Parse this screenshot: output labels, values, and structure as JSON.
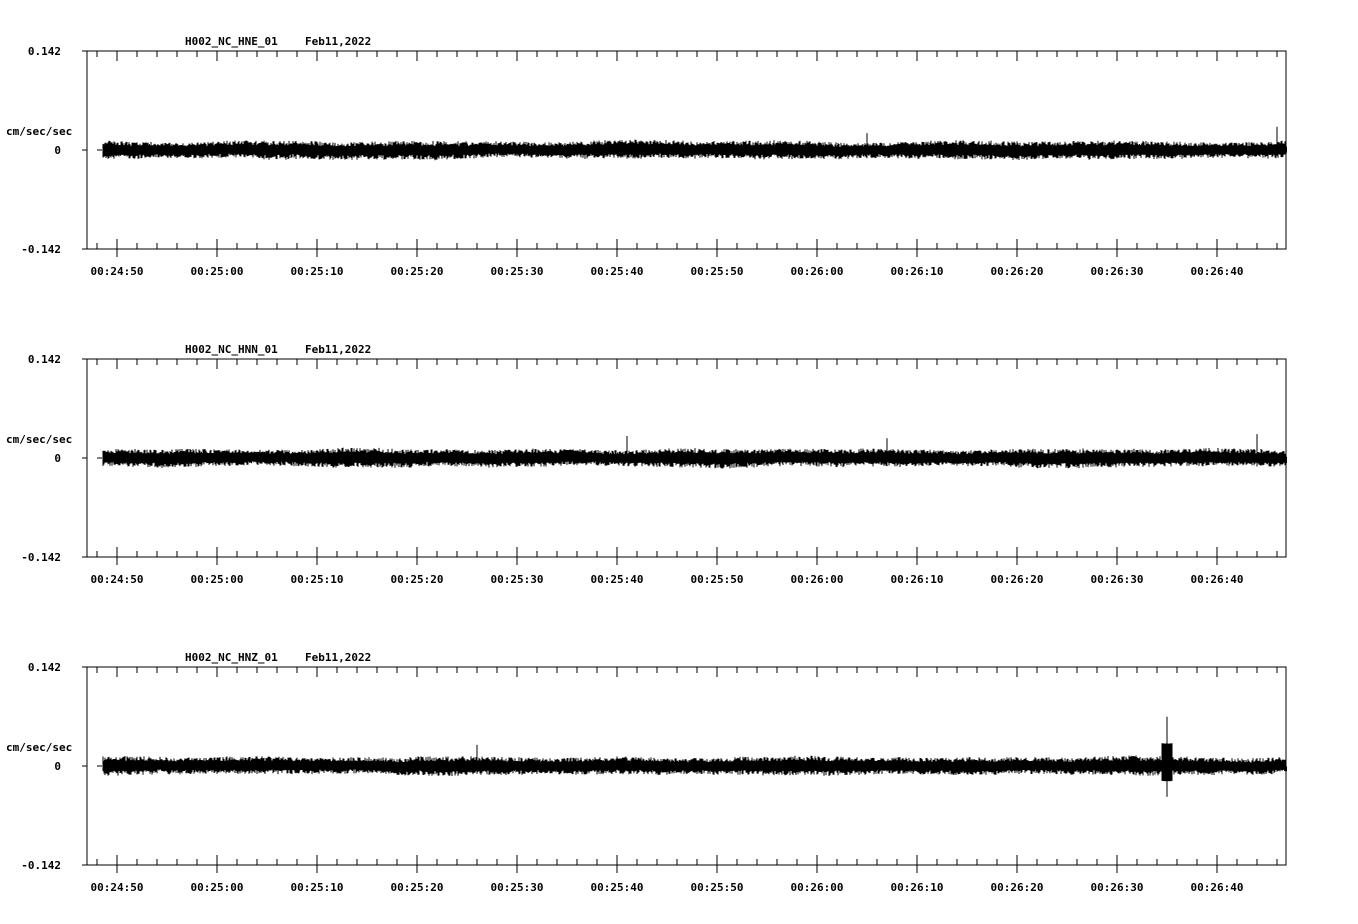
{
  "chart_data": [
    {
      "type": "line",
      "title": "H002_NC_HNE_01",
      "date": "Feb11,2022",
      "ylabel": "cm/sec/sec",
      "ylim": [
        -0.142,
        0.142
      ],
      "y_ticks": [
        "0.142",
        "0",
        "-0.142"
      ],
      "x_ticks": [
        "00:24:50",
        "00:25:00",
        "00:25:10",
        "00:25:20",
        "00:25:30",
        "00:25:40",
        "00:25:50",
        "00:26:00",
        "00:26:10",
        "00:26:20",
        "00:26:30",
        "00:26:40"
      ],
      "color": "#000000",
      "trace": {
        "amplitude": 0.012,
        "events": [
          {
            "t": "00:26:05",
            "peak": 0.025
          },
          {
            "t": "00:26:46",
            "peak": 0.033
          }
        ]
      }
    },
    {
      "type": "line",
      "title": "H002_NC_HNN_01",
      "date": "Feb11,2022",
      "ylabel": "cm/sec/sec",
      "ylim": [
        -0.142,
        0.142
      ],
      "y_ticks": [
        "0.142",
        "0",
        "-0.142"
      ],
      "x_ticks": [
        "00:24:50",
        "00:25:00",
        "00:25:10",
        "00:25:20",
        "00:25:30",
        "00:25:40",
        "00:25:50",
        "00:26:00",
        "00:26:10",
        "00:26:20",
        "00:26:30",
        "00:26:40"
      ],
      "color": "#000000",
      "trace": {
        "amplitude": 0.012,
        "events": [
          {
            "t": "00:25:41",
            "peak": 0.032
          },
          {
            "t": "00:26:07",
            "peak": 0.028
          },
          {
            "t": "00:26:44",
            "peak": 0.034
          }
        ]
      }
    },
    {
      "type": "line",
      "title": "H002_NC_HNZ_01",
      "date": "Feb11,2022",
      "ylabel": "cm/sec/sec",
      "ylim": [
        -0.142,
        0.142
      ],
      "y_ticks": [
        "0.142",
        "0",
        "-0.142"
      ],
      "x_ticks": [
        "00:24:50",
        "00:25:00",
        "00:25:10",
        "00:25:20",
        "00:25:30",
        "00:25:40",
        "00:25:50",
        "00:26:00",
        "00:26:10",
        "00:26:20",
        "00:26:30",
        "00:26:40"
      ],
      "color": "#000000",
      "trace": {
        "amplitude": 0.012,
        "events": [
          {
            "t": "00:25:26",
            "peak": 0.03
          },
          {
            "t": "00:26:35",
            "peak": 0.07,
            "trough": -0.045
          }
        ]
      }
    }
  ]
}
